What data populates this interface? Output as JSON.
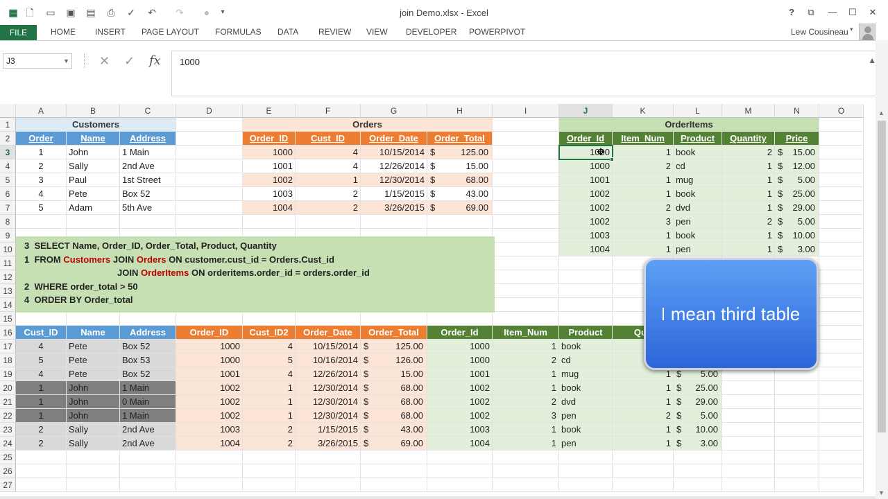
{
  "window": {
    "title": "join Demo.xlsx - Excel",
    "help": "?",
    "controls": [
      "⧉",
      "—",
      "☐",
      "✕"
    ]
  },
  "qat_icons": [
    "excel-logo-icon",
    "new-file-icon",
    "open-folder-icon",
    "save-icon",
    "print-preview-icon",
    "print-icon",
    "spelling-icon",
    "undo-icon",
    "redo-icon",
    "circle-icon",
    "customize-icon"
  ],
  "ribbon": {
    "file": "FILE",
    "tabs": [
      "HOME",
      "INSERT",
      "PAGE LAYOUT",
      "FORMULAS",
      "DATA",
      "REVIEW",
      "VIEW",
      "DEVELOPER",
      "POWERPIVOT"
    ],
    "user": "Lew Cousineau"
  },
  "namebox": "J3",
  "formula_value": "1000",
  "columns": [
    "A",
    "B",
    "C",
    "D",
    "E",
    "F",
    "G",
    "H",
    "I",
    "J",
    "K",
    "L",
    "M",
    "N",
    "O"
  ],
  "rows": [
    "1",
    "2",
    "3",
    "4",
    "5",
    "6",
    "7",
    "8",
    "9",
    "10",
    "11",
    "12",
    "13",
    "14",
    "15",
    "16",
    "17",
    "18",
    "19",
    "20",
    "21",
    "22",
    "23",
    "24",
    "25",
    "26",
    "27"
  ],
  "customers": {
    "title": "Customers",
    "headers": [
      "Order",
      "Name",
      "Address"
    ],
    "rows": [
      [
        "1",
        "John",
        "1 Main"
      ],
      [
        "2",
        "Sally",
        "2nd Ave"
      ],
      [
        "3",
        "Paul",
        "1st Street"
      ],
      [
        "4",
        "Pete",
        "Box 52"
      ],
      [
        "5",
        "Adam",
        "5th Ave"
      ]
    ]
  },
  "orders": {
    "title": "Orders",
    "headers": [
      "Order_ID",
      "Cust_ID",
      "Order_Date",
      "Order_Total"
    ],
    "rows": [
      [
        "1000",
        "4",
        "10/15/2014",
        "125.00"
      ],
      [
        "1001",
        "4",
        "12/26/2014",
        "15.00"
      ],
      [
        "1002",
        "1",
        "12/30/2014",
        "68.00"
      ],
      [
        "1003",
        "2",
        "1/15/2015",
        "43.00"
      ],
      [
        "1004",
        "2",
        "3/26/2015",
        "69.00"
      ]
    ]
  },
  "orderitems": {
    "title": "OrderItems",
    "headers": [
      "Order_Id",
      "Item_Num",
      "Product",
      "Quantity",
      "Price"
    ],
    "rows": [
      [
        "1000",
        "1",
        "book",
        "2",
        "15.00"
      ],
      [
        "1000",
        "2",
        "cd",
        "1",
        "12.00"
      ],
      [
        "1001",
        "1",
        "mug",
        "1",
        "5.00"
      ],
      [
        "1002",
        "1",
        "book",
        "1",
        "25.00"
      ],
      [
        "1002",
        "2",
        "dvd",
        "1",
        "29.00"
      ],
      [
        "1002",
        "3",
        "pen",
        "2",
        "5.00"
      ],
      [
        "1003",
        "1",
        "book",
        "1",
        "10.00"
      ],
      [
        "1004",
        "1",
        "pen",
        "1",
        "3.00"
      ]
    ]
  },
  "currency": "$",
  "sql": {
    "l1_num": "3",
    "l1": "SELECT Name, Order_ID, Order_Total, Product, Quantity",
    "l2_num": "1",
    "l2_from": "FROM ",
    "l2_t1": "Customers",
    "l2_join": " JOIN ",
    "l2_t2": "Orders",
    "l2_on": " ON customer.cust_id = Orders.Cust_id",
    "l3_join": "JOIN ",
    "l3_t3": "OrderItems",
    "l3_on": " ON orderitems.order_id = orders.order_id",
    "l4_num": "2",
    "l4": "WHERE order_total > 50",
    "l5_num": "4",
    "l5": "ORDER BY Order_total"
  },
  "result": {
    "headers": [
      "Cust_ID",
      "Name",
      "Address",
      "Order_ID",
      "Cust_ID2",
      "Order_Date",
      "Order_Total",
      "Order_Id",
      "Item_Num",
      "Product",
      "Qua"
    ],
    "rows": [
      [
        "4",
        "Pete",
        "Box 52",
        "1000",
        "4",
        "10/15/2014",
        "125.00",
        "1000",
        "1",
        "book",
        "",
        ""
      ],
      [
        "5",
        "Pete",
        "Box 53",
        "1000",
        "5",
        "10/16/2014",
        "126.00",
        "1000",
        "2",
        "cd",
        "",
        ""
      ],
      [
        "4",
        "Pete",
        "Box 52",
        "1001",
        "4",
        "12/26/2014",
        "15.00",
        "1001",
        "1",
        "mug",
        "1",
        "5.00"
      ],
      [
        "1",
        "John",
        "1 Main",
        "1002",
        "1",
        "12/30/2014",
        "68.00",
        "1002",
        "1",
        "book",
        "1",
        "25.00"
      ],
      [
        "1",
        "John",
        "0 Main",
        "1002",
        "1",
        "12/30/2014",
        "68.00",
        "1002",
        "2",
        "dvd",
        "1",
        "29.00"
      ],
      [
        "1",
        "John",
        "1 Main",
        "1002",
        "1",
        "12/30/2014",
        "68.00",
        "1002",
        "3",
        "pen",
        "2",
        "5.00"
      ],
      [
        "2",
        "Sally",
        "2nd Ave",
        "1003",
        "2",
        "1/15/2015",
        "43.00",
        "1003",
        "1",
        "book",
        "1",
        "10.00"
      ],
      [
        "2",
        "Sally",
        "2nd Ave",
        "1004",
        "2",
        "3/26/2015",
        "69.00",
        "1004",
        "1",
        "pen",
        "1",
        "3.00"
      ]
    ]
  },
  "selected_value": "1000",
  "callout": "mean third table",
  "colors": {
    "excel_green": "#217346",
    "blue": "#5b9bd5",
    "orange": "#ed7d31",
    "green": "#548235"
  }
}
